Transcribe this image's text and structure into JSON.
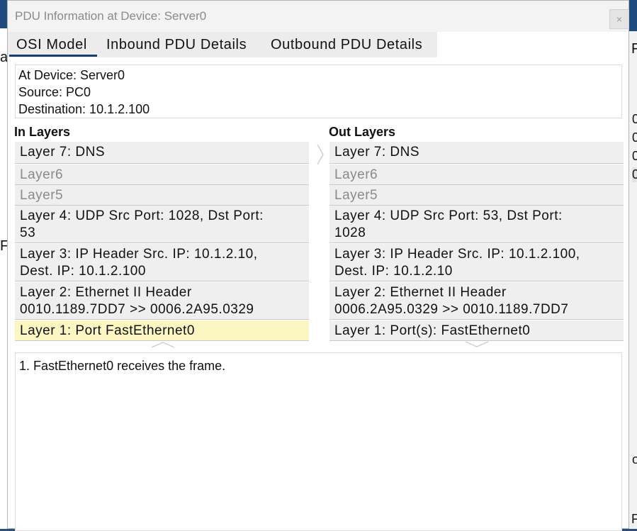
{
  "window": {
    "title": "PDU Information at Device: Server0",
    "close_label": "×"
  },
  "tabs": [
    {
      "label": "OSI Model",
      "active": true
    },
    {
      "label": "Inbound PDU Details",
      "active": false
    },
    {
      "label": "Outbound PDU Details",
      "active": false
    }
  ],
  "info": {
    "device": "At Device: Server0",
    "source": "Source: PC0",
    "destination": "Destination: 10.1.2.100"
  },
  "in_layers": {
    "heading": "In Layers",
    "items": [
      {
        "lines": [
          "Layer 7: DNS"
        ],
        "enabled": true,
        "selected": false
      },
      {
        "lines": [
          "Layer6"
        ],
        "enabled": false,
        "selected": false
      },
      {
        "lines": [
          "Layer5"
        ],
        "enabled": false,
        "selected": false
      },
      {
        "lines": [
          "Layer 4: UDP Src Port: 1028, Dst Port:",
          "53"
        ],
        "enabled": true,
        "selected": false
      },
      {
        "lines": [
          "Layer 3: IP Header Src. IP: 10.1.2.10,",
          "Dest. IP: 10.1.2.100"
        ],
        "enabled": true,
        "selected": false
      },
      {
        "lines": [
          "Layer 2: Ethernet II Header",
          "0010.1189.7DD7 >> 0006.2A95.0329"
        ],
        "enabled": true,
        "selected": false
      },
      {
        "lines": [
          "Layer 1: Port FastEthernet0"
        ],
        "enabled": true,
        "selected": true
      }
    ]
  },
  "out_layers": {
    "heading": "Out Layers",
    "items": [
      {
        "lines": [
          "Layer 7: DNS"
        ],
        "enabled": true,
        "selected": false
      },
      {
        "lines": [
          "Layer6"
        ],
        "enabled": false,
        "selected": false
      },
      {
        "lines": [
          "Layer5"
        ],
        "enabled": false,
        "selected": false
      },
      {
        "lines": [
          "Layer 4: UDP Src Port: 53, Dst Port:",
          "1028"
        ],
        "enabled": true,
        "selected": false
      },
      {
        "lines": [
          "Layer 3: IP Header Src. IP: 10.1.2.100,",
          "Dest. IP: 10.1.2.10"
        ],
        "enabled": true,
        "selected": false
      },
      {
        "lines": [
          "Layer 2: Ethernet II Header",
          "0006.2A95.0329 >> 0010.1189.7DD7"
        ],
        "enabled": true,
        "selected": false
      },
      {
        "lines": [
          "Layer 1: Port(s): FastEthernet0"
        ],
        "enabled": true,
        "selected": false
      }
    ]
  },
  "description": "1. FastEthernet0 receives the frame.",
  "background_fragments": {
    "left": [
      "a",
      "F"
    ],
    "right": [
      "F",
      "0",
      "0",
      "0",
      "0",
      "o",
      "F"
    ]
  },
  "colors": {
    "selected_layer_bg": "#fbf6c2",
    "layer_bg": "#efefef",
    "tab_underline": "#1e3c6b",
    "titlebar_bg": "#f3f3f3"
  }
}
